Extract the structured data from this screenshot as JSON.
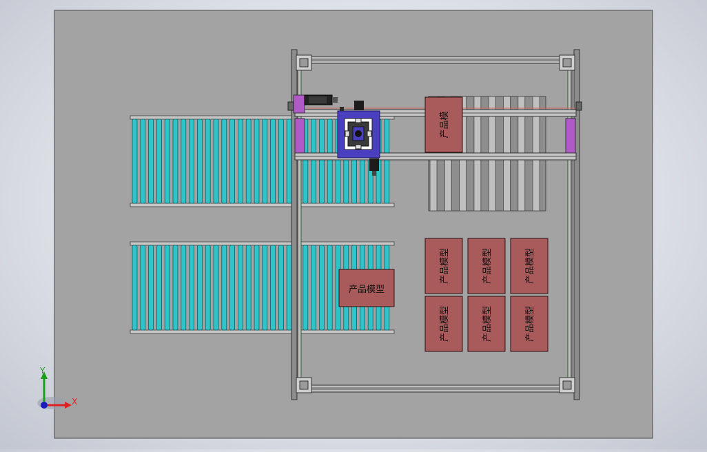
{
  "scene": {
    "sheet_color": "#a3a3a3",
    "roller_color": "#2ec4c9",
    "box_color": "#a95a5a",
    "box_label": "产品模型",
    "pallet_label_partial": "产品模",
    "carriage_color": "#4a3fbf",
    "accent_color": "#b05ac8"
  },
  "boxes": {
    "loose": {
      "label": "产品模型"
    },
    "pallet_top": {
      "label": "产品模"
    },
    "grid": [
      {
        "label": "产品模型"
      },
      {
        "label": "产品模型"
      },
      {
        "label": "产品模型"
      },
      {
        "label": "产品模型"
      },
      {
        "label": "产品模型"
      },
      {
        "label": "产品模型"
      }
    ]
  },
  "triad": {
    "x_label": "X",
    "y_label": "Y",
    "x_color": "#e02020",
    "y_color": "#18a018",
    "origin_color": "#1a1ac0"
  }
}
